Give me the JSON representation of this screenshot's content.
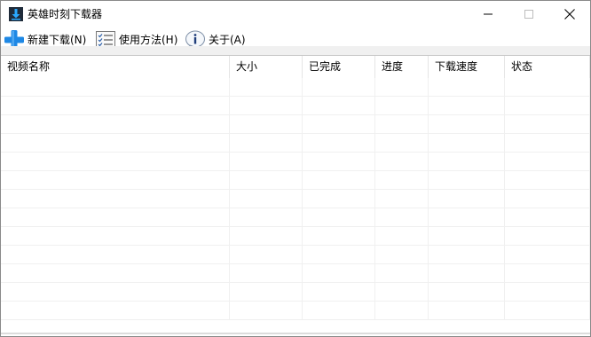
{
  "window": {
    "title": "英雄时刻下载器",
    "icon": "download-arrow-icon"
  },
  "toolbar": {
    "new_download_label": "新建下载(N)",
    "usage_label": "使用方法(H)",
    "about_label": "关于(A)"
  },
  "table": {
    "columns": [
      "视频名称",
      "大小",
      "已完成",
      "进度",
      "下载速度",
      "状态"
    ],
    "rows": []
  },
  "colors": {
    "accent_blue": "#1e88e5",
    "header_strip": "#f0f0f0",
    "grid_line": "#f0f0f0"
  }
}
